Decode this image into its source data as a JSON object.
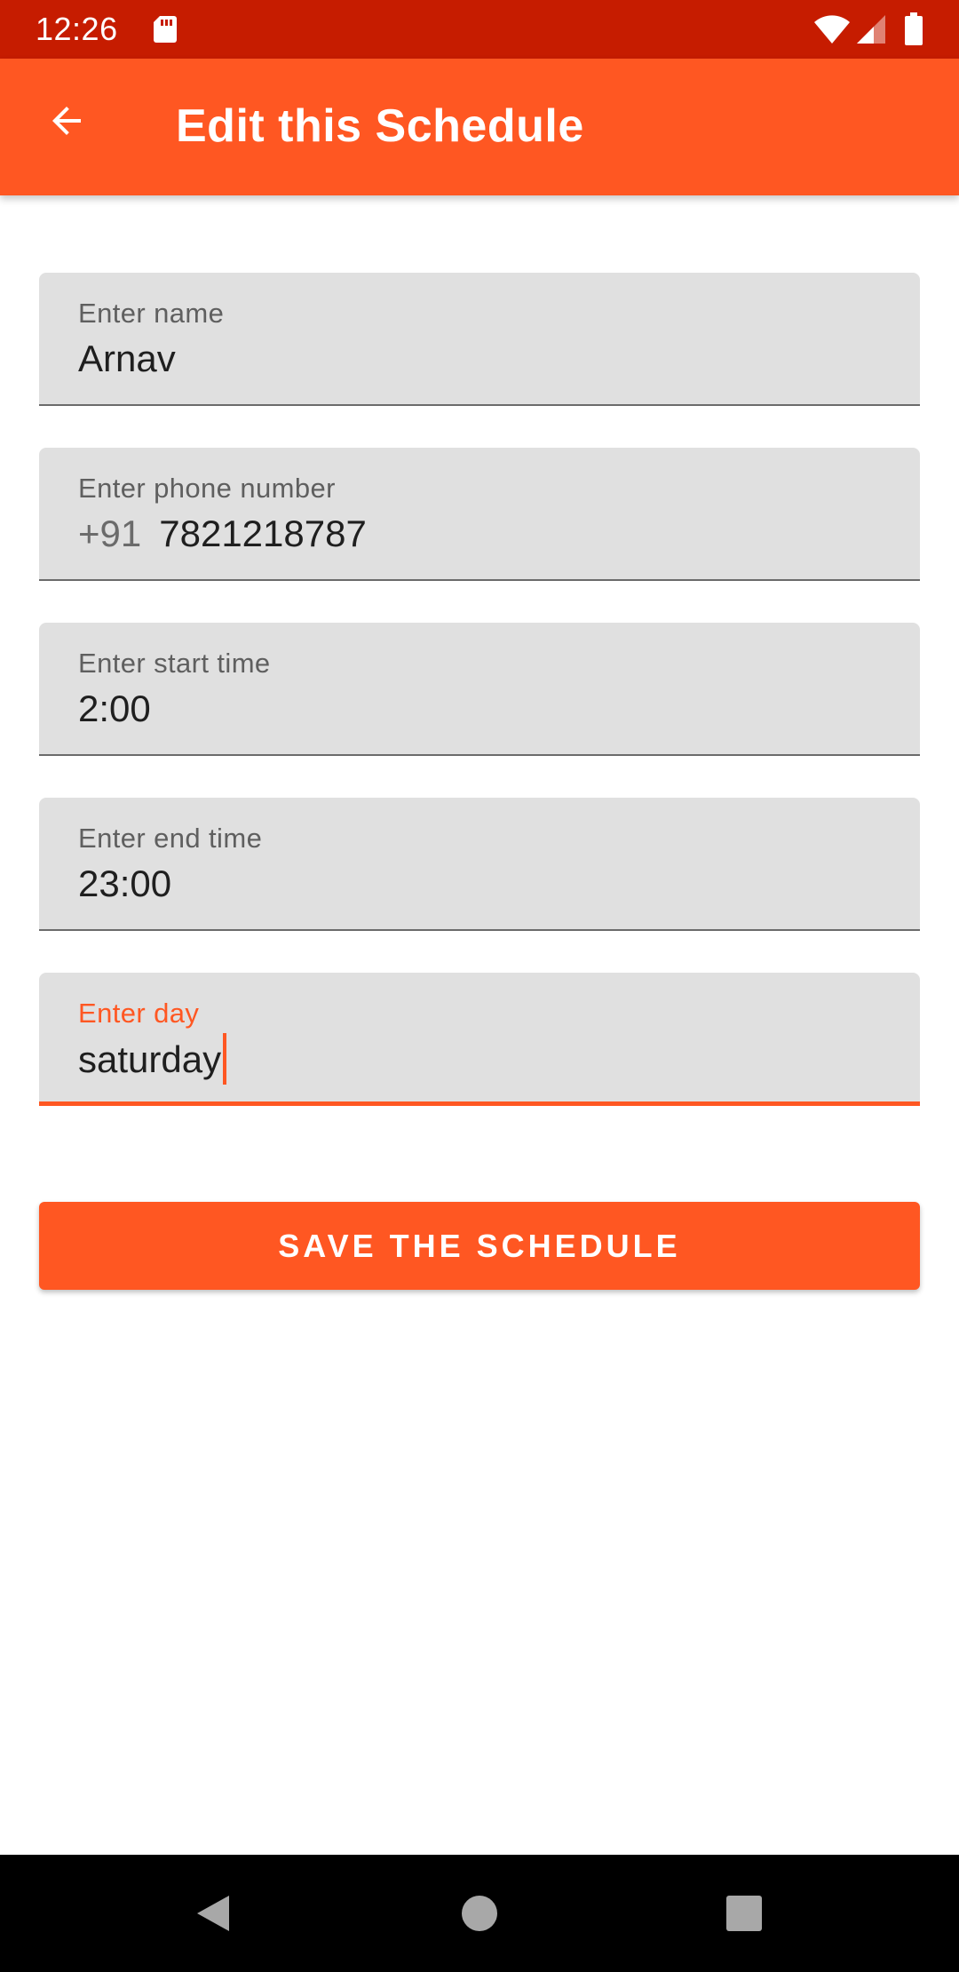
{
  "status_bar": {
    "time": "12:26",
    "icons": [
      "sd-card-icon",
      "wifi-icon",
      "cell-signal-icon",
      "battery-icon"
    ]
  },
  "app_bar": {
    "back_icon": "arrow-back-icon",
    "title": "Edit this Schedule"
  },
  "form": {
    "fields": [
      {
        "label": "Enter name",
        "value": "Arnav"
      },
      {
        "label": "Enter phone number",
        "prefix": "+91",
        "value": "7821218787"
      },
      {
        "label": "Enter start time",
        "value": "2:00"
      },
      {
        "label": "Enter end time",
        "value": "23:00"
      },
      {
        "label": "Enter day",
        "value": "saturday",
        "focused": true
      }
    ],
    "save_label": "SAVE THE SCHEDULE"
  },
  "nav_bar": {
    "icons": [
      "nav-back-icon",
      "nav-home-icon",
      "nav-recents-icon"
    ]
  },
  "colors": {
    "status_bar": "#c61c00",
    "primary": "#ff5722",
    "field_background": "#e0e0e0",
    "nav_bar": "#000000"
  }
}
